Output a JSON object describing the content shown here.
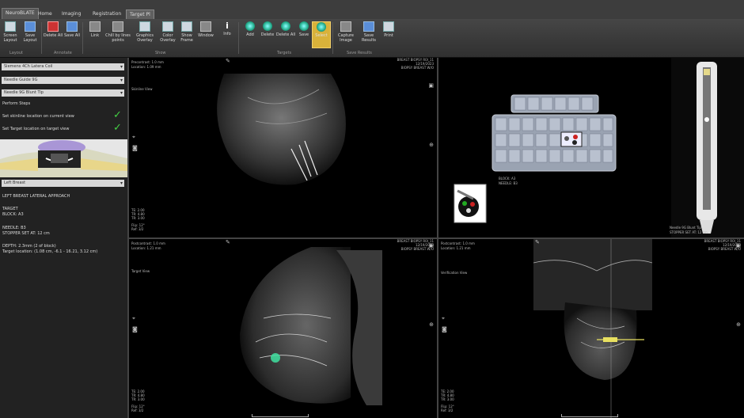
{
  "tabs": {
    "app": "NeuroBLATE",
    "items": [
      "Home",
      "Imaging",
      "Registration",
      "Target Pl"
    ]
  },
  "ribbon": {
    "buttons": [
      {
        "label": "Screen Layout",
        "icon": "screen-layout-icon"
      },
      {
        "label": "Save Layout",
        "icon": "save-layout-icon"
      },
      {
        "label": "Delete All",
        "icon": "delete-all-icon"
      },
      {
        "label": "Save All",
        "icon": "save-all-icon"
      },
      {
        "label": "Link",
        "icon": "link-icon"
      },
      {
        "label": "Chill by lines points",
        "icon": "points-icon"
      },
      {
        "label": "Graphics Overlay",
        "icon": "graphics-overlay-icon"
      },
      {
        "label": "Color Overlay",
        "icon": "color-overlay-icon"
      },
      {
        "label": "Show Frame",
        "icon": "show-frame-icon"
      },
      {
        "label": "Window",
        "icon": "window-icon"
      },
      {
        "label": "Info",
        "icon": "info-icon"
      },
      {
        "label": "Add",
        "icon": "add-target-icon"
      },
      {
        "label": "Delete",
        "icon": "delete-target-icon"
      },
      {
        "label": "Delete All",
        "icon": "delete-all-targets-icon"
      },
      {
        "label": "Save",
        "icon": "save-target-icon"
      },
      {
        "label": "Select",
        "icon": "select-target-icon"
      },
      {
        "label": "Capture Image",
        "icon": "camera-icon"
      },
      {
        "label": "Save Results",
        "icon": "save-results-icon"
      },
      {
        "label": "Print",
        "icon": "print-icon"
      }
    ],
    "groups": [
      "Layout",
      "Annotate",
      "Show",
      "Targets",
      "Save Results"
    ]
  },
  "left_panel": {
    "dropdowns": [
      "Siemens 4Ch Latera Coil",
      "Needle Guide 9G",
      "Needle 9G Blunt Tip"
    ],
    "section_title": "Perform Steps",
    "steps": [
      "Set skinline location on current view",
      "Set Target location on target view"
    ],
    "approach_select": "Left Breast",
    "approach_title": "LEFT BREAST LATERAL APPROACH",
    "target_label": "TARGET",
    "target_value": "BLOCK: A3",
    "needle_label": "NEEDLE: B3",
    "needle_value": "STOPPER SET AT: 12 cm",
    "depth_label": "DEPTH: 2.3mm (2 of block)",
    "target_location": "Target location: (1.08 cm, -6.1 - 16.21, 3.12 cm)"
  },
  "views": {
    "top_left": {
      "series": "Precontrast: 1.0 mm",
      "location": "Location: 1.09 mm",
      "title": "Skinline View",
      "tr1": "BREAST BIOPSY R0I_11",
      "tr2": "12/19/2023",
      "tr3": "BIOPSY BREAST W/O",
      "bl1": "TE: 2.00",
      "bl2": "TR: 4.80",
      "bl3": "TR: 3.00",
      "bl4": "Flip: 12°",
      "bl5": "Ref: 3/2"
    },
    "bottom_left": {
      "series": "Postcontrast: 1.0 mm",
      "location": "Location: 1.21 mm",
      "title": "Target View",
      "tr1": "BREAST BIOPSY R0I_11",
      "tr2": "12/19/2023",
      "tr3": "BIOPSY BREAST W/O",
      "bl1": "TE: 2.00",
      "bl2": "TR: 4.80",
      "bl3": "TR: 3.00",
      "bl4": "Flip: 12°",
      "bl5": "Ref: 3/2"
    },
    "bottom_right": {
      "series": "Postcontrast: 1.0 mm",
      "location": "Location: 1.21 mm",
      "title": "Verification View",
      "tr1": "BREAST BIOPSY R0I_11",
      "tr2": "12/19/2023",
      "tr3": "BIOPSY BREAST W/O",
      "bl1": "TE: 2.00",
      "bl2": "TR: 4.80",
      "bl3": "TR: 3.00",
      "bl4": "Flip: 12°",
      "bl5": "Ref: 3/2"
    },
    "grid": {
      "block": "BLOCK: A3",
      "needle": "NEEDLE: B3"
    },
    "needle_panel": {
      "label": "Needle 9G Blunt Tip",
      "stopper": "STOPPER SET AT: 12 cm"
    }
  },
  "colors": {
    "accent_check": "#44d144",
    "highlight_button": "#d9b23a",
    "target_marker": "#3fe0a0",
    "crosshair": "#e8e060"
  }
}
